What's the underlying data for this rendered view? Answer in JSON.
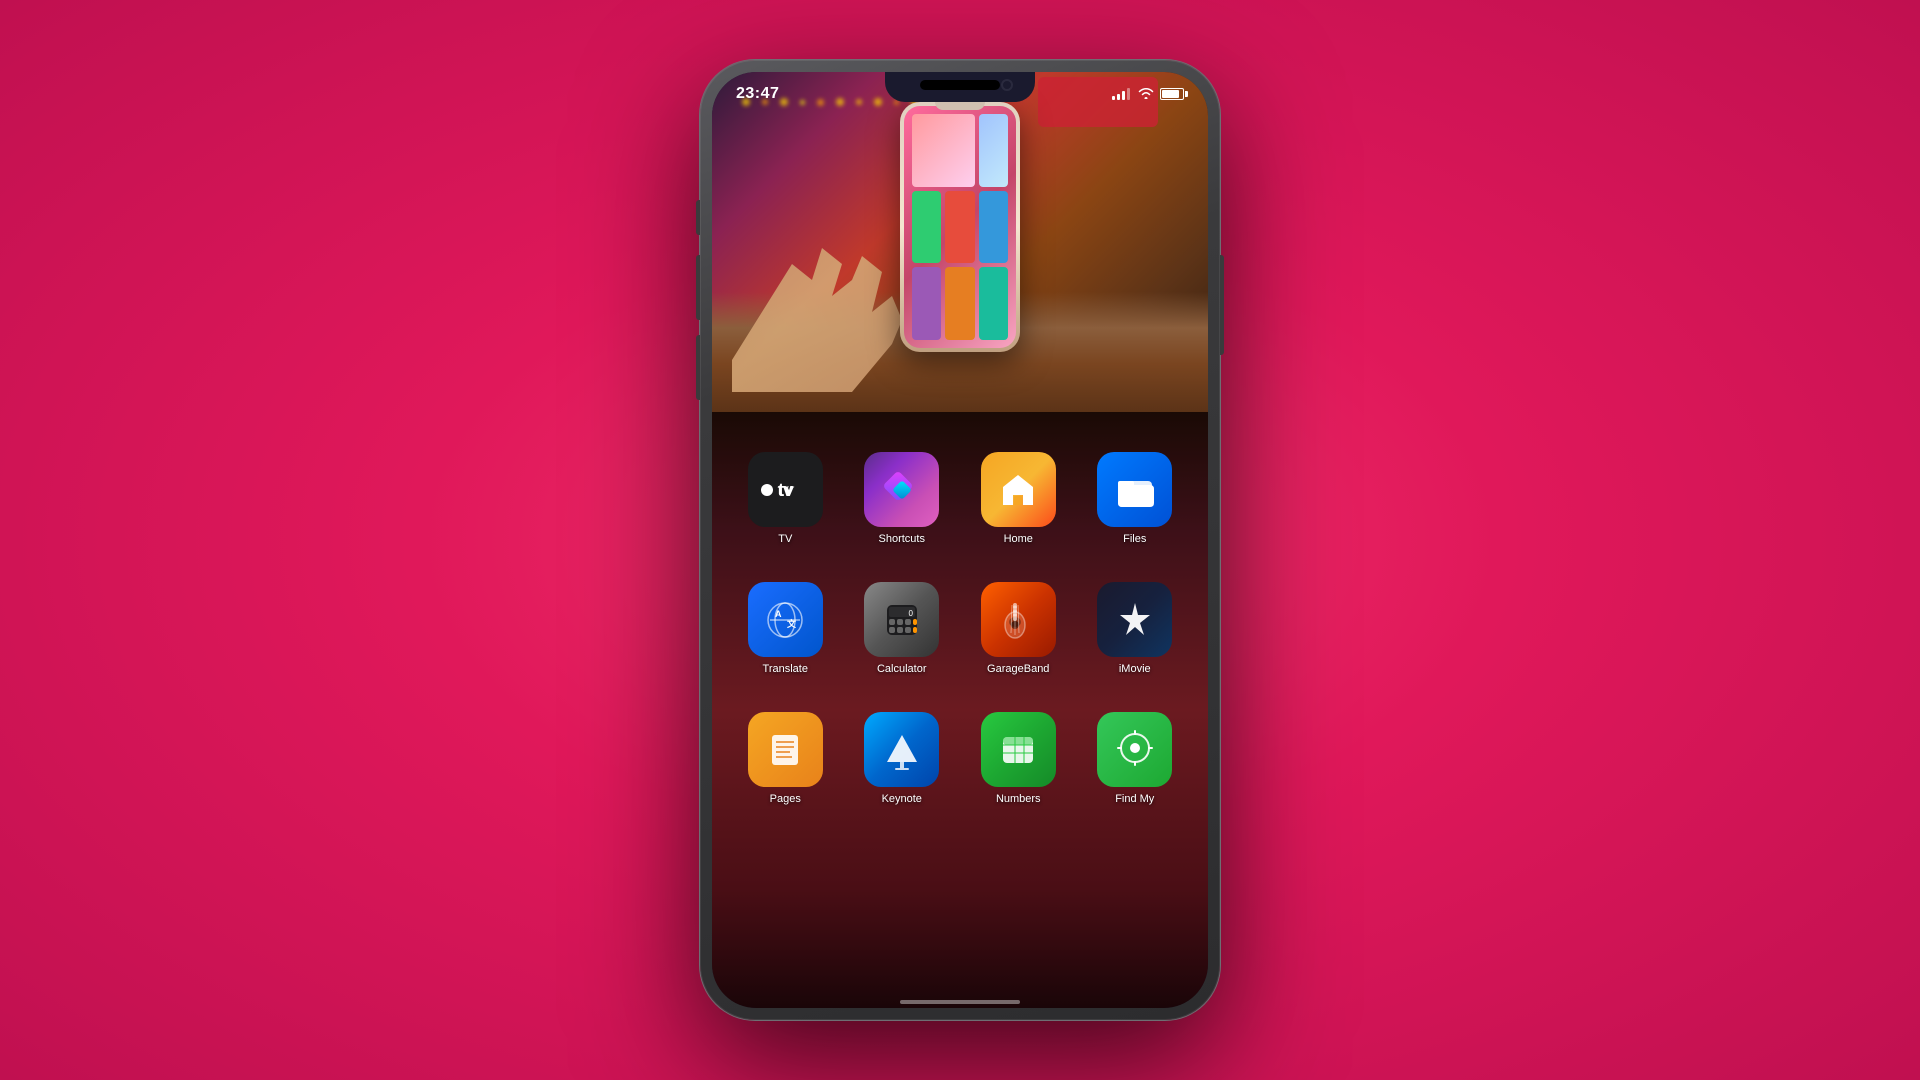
{
  "background": {
    "color": "#e0185a"
  },
  "phone": {
    "status_bar": {
      "time": "23:47",
      "signal_bars": [
        4,
        6,
        8,
        10,
        12
      ],
      "battery_level": "85%"
    },
    "video": {
      "label": "Video preview area"
    },
    "apps": {
      "row1": [
        {
          "id": "tv",
          "label": "TV",
          "icon_type": "tv"
        },
        {
          "id": "shortcuts",
          "label": "Shortcuts",
          "icon_type": "shortcuts"
        },
        {
          "id": "home",
          "label": "Home",
          "icon_type": "home"
        },
        {
          "id": "files",
          "label": "Files",
          "icon_type": "files"
        }
      ],
      "row2": [
        {
          "id": "translate",
          "label": "Translate",
          "icon_type": "translate"
        },
        {
          "id": "calculator",
          "label": "Calculator",
          "icon_type": "calculator"
        },
        {
          "id": "garageband",
          "label": "GarageBand",
          "icon_type": "garageband"
        },
        {
          "id": "imovie",
          "label": "iMovie",
          "icon_type": "imovie"
        }
      ],
      "row3": [
        {
          "id": "pages",
          "label": "Pages",
          "icon_type": "pages"
        },
        {
          "id": "keynote",
          "label": "Keynote",
          "icon_type": "keynote"
        },
        {
          "id": "numbers",
          "label": "Numbers",
          "icon_type": "numbers"
        },
        {
          "id": "findmy",
          "label": "Find My",
          "icon_type": "findmy"
        }
      ]
    }
  }
}
